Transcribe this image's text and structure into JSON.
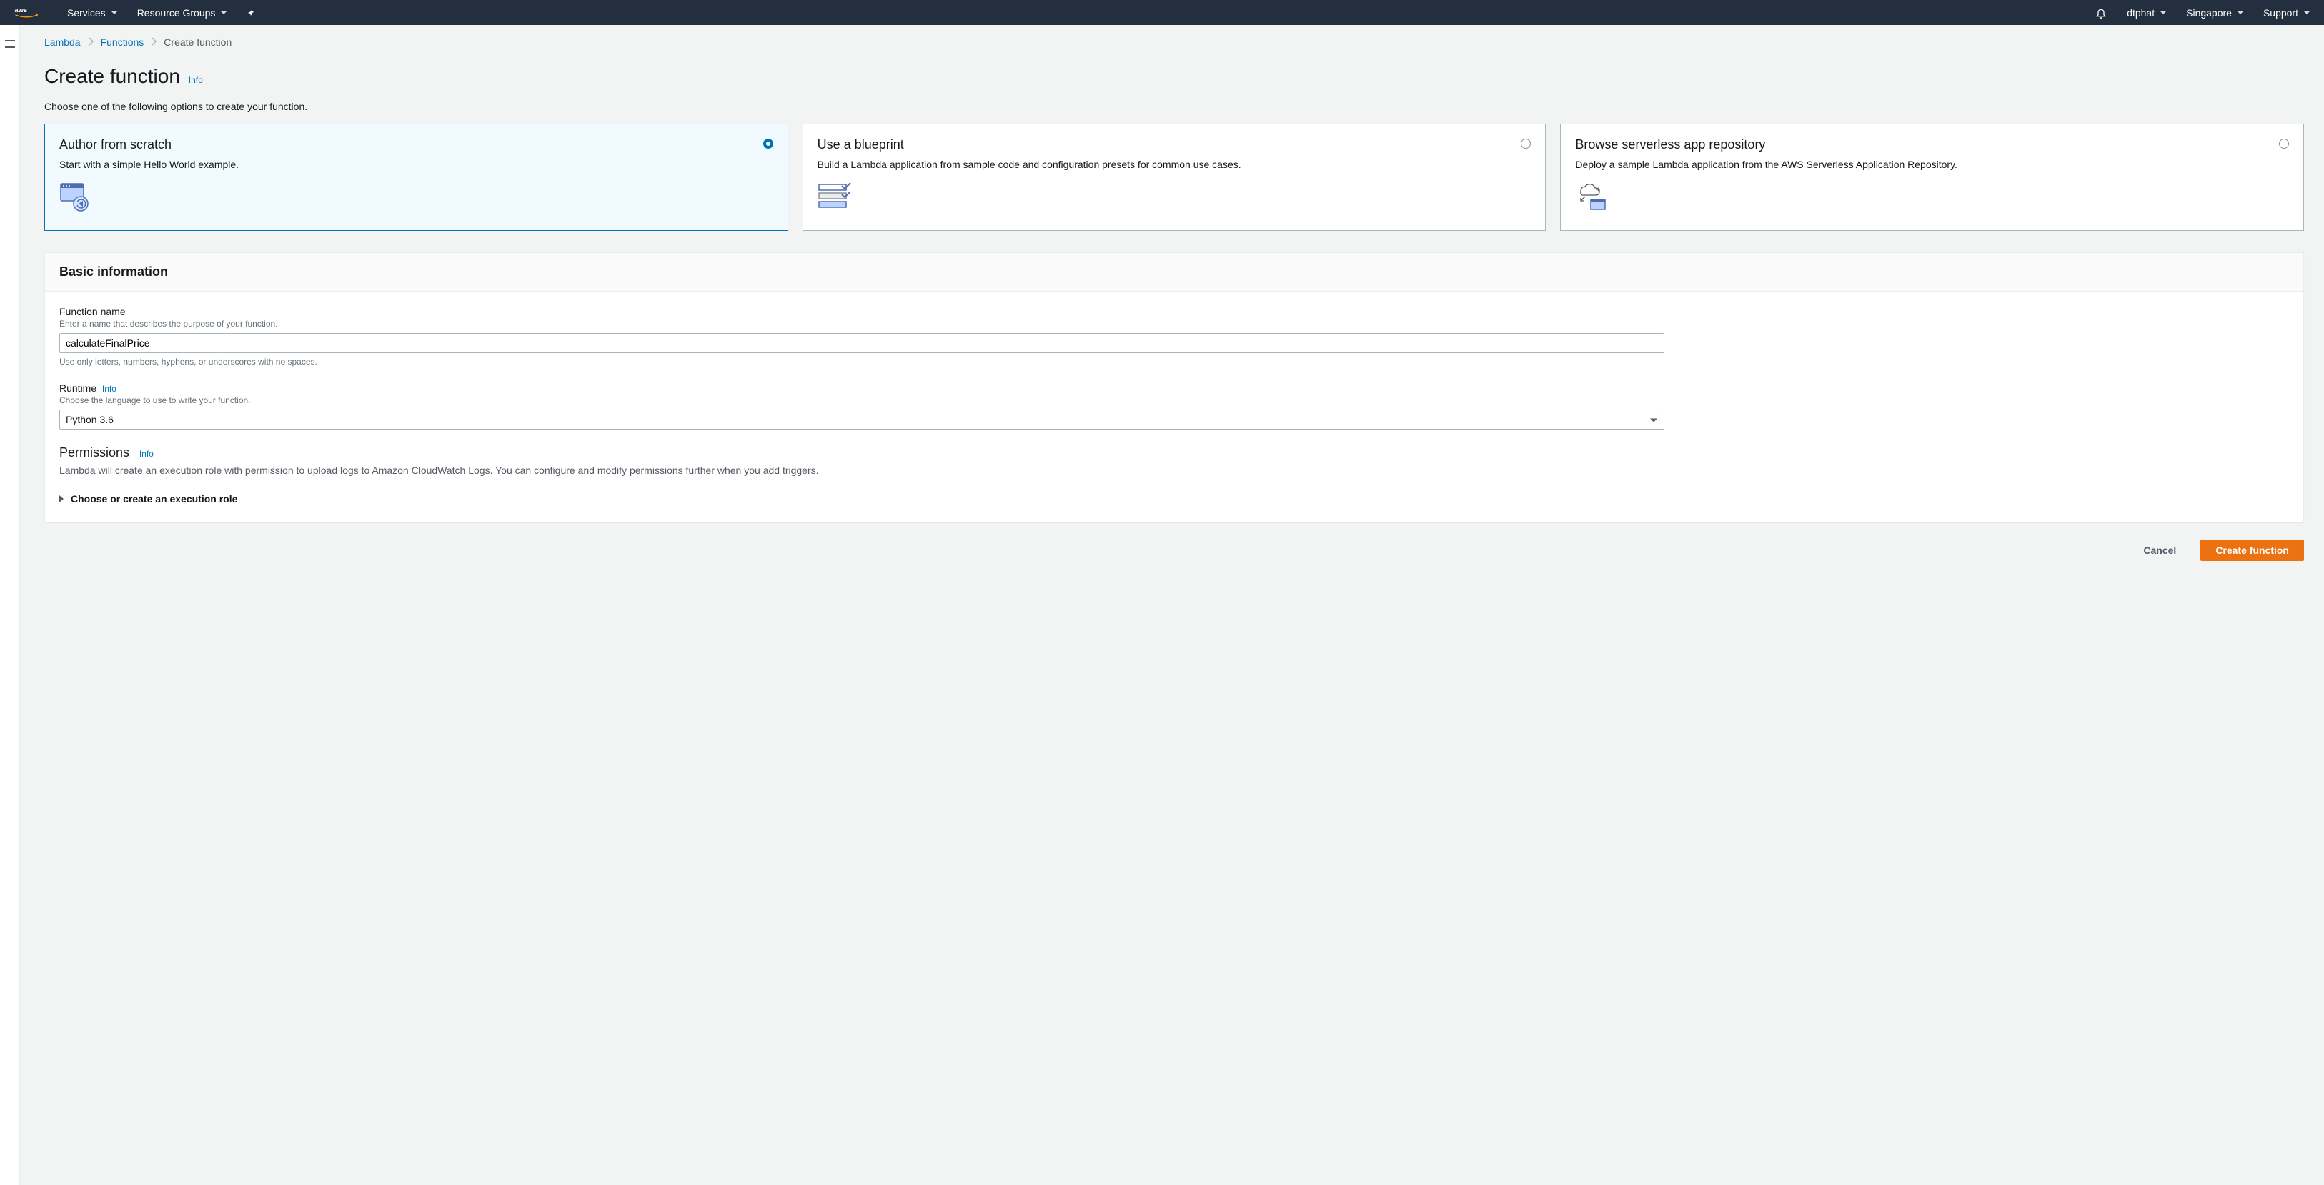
{
  "nav": {
    "services": "Services",
    "resource_groups": "Resource Groups",
    "user": "dtphat",
    "region": "Singapore",
    "support": "Support"
  },
  "breadcrumb": {
    "root": "Lambda",
    "functions": "Functions",
    "current": "Create function"
  },
  "page": {
    "title": "Create function",
    "info": "Info",
    "subtitle": "Choose one of the following options to create your function."
  },
  "options": {
    "scratch": {
      "title": "Author from scratch",
      "desc": "Start with a simple Hello World example."
    },
    "blueprint": {
      "title": "Use a blueprint",
      "desc": "Build a Lambda application from sample code and configuration presets for common use cases."
    },
    "repo": {
      "title": "Browse serverless app repository",
      "desc": "Deploy a sample Lambda application from the AWS Serverless Application Repository."
    }
  },
  "basic": {
    "heading": "Basic information",
    "fn_label": "Function name",
    "fn_hint": "Enter a name that describes the purpose of your function.",
    "fn_value": "calculateFinalPrice",
    "fn_constraint": "Use only letters, numbers, hyphens, or underscores with no spaces.",
    "rt_label": "Runtime",
    "rt_info": "Info",
    "rt_hint": "Choose the language to use to write your function.",
    "rt_value": "Python 3.6"
  },
  "perm": {
    "heading": "Permissions",
    "info": "Info",
    "desc": "Lambda will create an execution role with permission to upload logs to Amazon CloudWatch Logs. You can configure and modify permissions further when you add triggers.",
    "expander": "Choose or create an execution role"
  },
  "footer": {
    "cancel": "Cancel",
    "create": "Create function"
  }
}
